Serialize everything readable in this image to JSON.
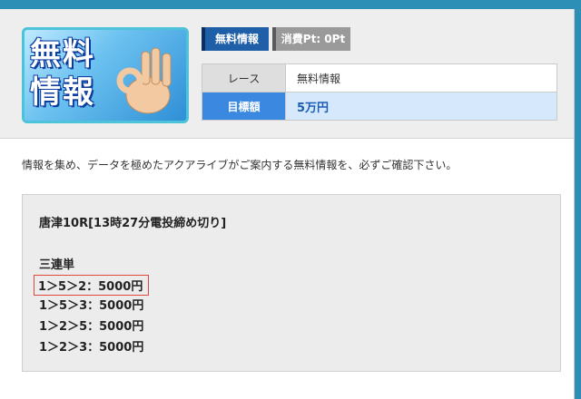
{
  "banner": {
    "line1": "無料",
    "line2": "情報"
  },
  "tabs": {
    "free": "無料情報",
    "points": "消費Pt: 0Pt"
  },
  "info": {
    "race_label": "レース",
    "race_value": "無料情報",
    "target_label": "目標額",
    "target_value": "5万円"
  },
  "description": "情報を集め、データを極めたアクアライブがご案内する無料情報を、必ずご確認下さい。",
  "tip": {
    "race": "唐津10R[13時27分電投締め切り]",
    "bet_type": "三連単",
    "bets": [
      "1＞5＞2：5000円",
      "1＞5＞3：5000円",
      "1＞2＞5：5000円",
      "1＞2＞3：5000円"
    ]
  },
  "colors": {
    "accent": "#3a88e0",
    "highlight_border": "#e0483a",
    "background": "#2e8fb6"
  }
}
